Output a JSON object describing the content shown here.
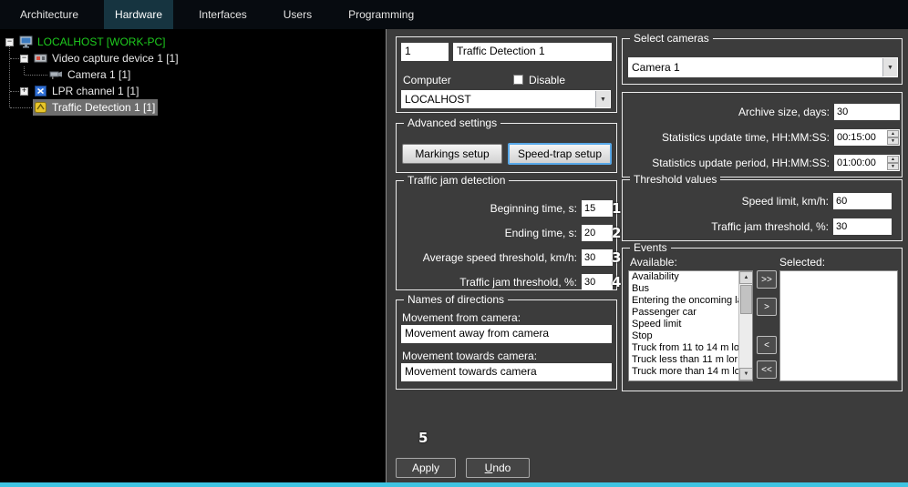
{
  "colors": {
    "accent_bar": "#3fc4e2",
    "host_green": "#1ecb1e",
    "focus_blue": "#58a8e8",
    "active_tab": "#163440"
  },
  "tabs": [
    {
      "label": "Architecture"
    },
    {
      "label": "Hardware"
    },
    {
      "label": "Interfaces"
    },
    {
      "label": "Users"
    },
    {
      "label": "Programming"
    }
  ],
  "tree": {
    "items": [
      {
        "label": "LOCALHOST [WORK-PC]"
      },
      {
        "label": "Video capture device 1 [1]"
      },
      {
        "label": "Camera 1 [1]"
      },
      {
        "label": "LPR channel  1 [1]"
      },
      {
        "label": "Traffic Detection 1 [1]"
      }
    ]
  },
  "identity": {
    "id": "1",
    "name": "Traffic Detection 1",
    "computer_label": "Computer",
    "disable_label": "Disable",
    "computer_value": "LOCALHOST"
  },
  "advanced": {
    "title": "Advanced settings",
    "markings_label": "Markings setup",
    "speedtrap_label": "Speed-trap setup"
  },
  "traffic_jam": {
    "title": "Traffic jam detection",
    "fields": [
      {
        "label": "Beginning time, s:",
        "value": "15",
        "annotation": "1"
      },
      {
        "label": "Ending time, s:",
        "value": "20",
        "annotation": "2"
      },
      {
        "label": "Average speed threshold, km/h:",
        "value": "30",
        "annotation": "3"
      },
      {
        "label": "Traffic jam threshold, %:",
        "value": "30",
        "annotation": "4"
      }
    ]
  },
  "directions": {
    "title": "Names of directions",
    "from_label": "Movement from camera:",
    "from_value": "Movement away from camera",
    "towards_label": "Movement towards camera:",
    "towards_value": "Movement towards camera"
  },
  "cameras": {
    "title": "Select cameras",
    "value": "Camera 1"
  },
  "statistics": {
    "archive_label": "Archive size, days:",
    "archive_value": "30",
    "update_time_label": "Statistics update time, HH:MM:SS:",
    "update_time_value": "00:15:00",
    "update_period_label": "Statistics update period, HH:MM:SS:",
    "update_period_value": "01:00:00"
  },
  "thresholds": {
    "title": "Threshold values",
    "speed_label": "Speed limit, km/h:",
    "speed_value": "60",
    "jam_label": "Traffic jam threshold, %:",
    "jam_value": "30"
  },
  "events": {
    "title": "Events",
    "available_label": "Available:",
    "selected_label": "Selected:",
    "available": [
      "Availability",
      "Bus",
      "Entering the oncoming la",
      "Passenger car",
      "Speed limit",
      "Stop",
      "Truck from 11 to 14 m lo",
      "Truck less than 11 m lor",
      "Truck more than 14 m lo"
    ],
    "selected": [],
    "buttons": {
      "add_all": ">>",
      "add": ">",
      "remove": "<",
      "remove_all": "<<"
    }
  },
  "footer": {
    "apply_label": "Apply",
    "undo_label": "Undo",
    "annotation": "5"
  }
}
